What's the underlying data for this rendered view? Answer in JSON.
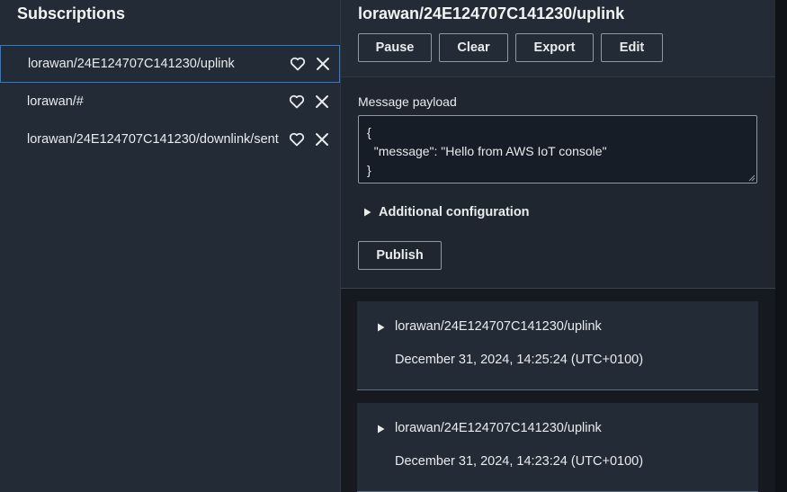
{
  "subscriptions": {
    "title": "Subscriptions",
    "items": [
      {
        "label": "lorawan/24E124707C141230/uplink",
        "selected": true
      },
      {
        "label": "lorawan/#",
        "selected": false
      },
      {
        "label": "lorawan/24E124707C141230/downlink/sent",
        "selected": false
      }
    ]
  },
  "topic": {
    "title": "lorawan/24E124707C141230/uplink",
    "buttons": {
      "pause": "Pause",
      "clear": "Clear",
      "export": "Export",
      "edit": "Edit"
    }
  },
  "publish": {
    "payload_label": "Message payload",
    "payload_value": "{\n  \"message\": \"Hello from AWS IoT console\"\n}",
    "additional_config": "Additional configuration",
    "publish_button": "Publish"
  },
  "messages": [
    {
      "topic": "lorawan/24E124707C141230/uplink",
      "time": "December 31, 2024, 14:25:24 (UTC+0100)"
    },
    {
      "topic": "lorawan/24E124707C141230/uplink",
      "time": "December 31, 2024, 14:23:24 (UTC+0100)"
    }
  ],
  "colors": {
    "selected_border": "#2b7bd3",
    "panel": "#232b37",
    "background": "#16191f"
  }
}
